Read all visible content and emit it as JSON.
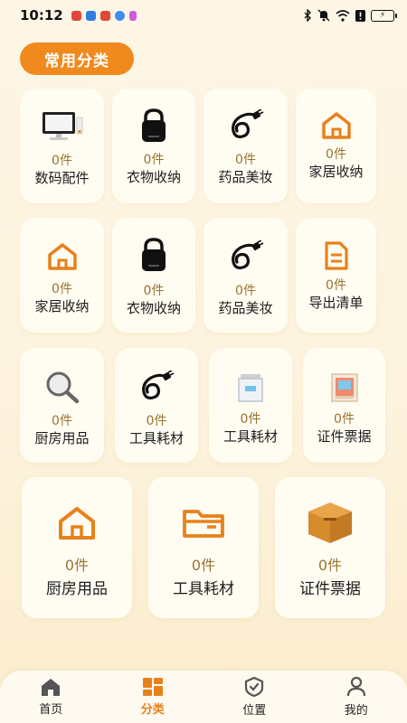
{
  "status_bar": {
    "time": "10:12",
    "battery_glyph": "⚡"
  },
  "section": {
    "title": "常用分类"
  },
  "row1": [
    {
      "icon": "monitor-icon",
      "count": "0件",
      "label": "数码配件"
    },
    {
      "icon": "lock-icon",
      "count": "0件",
      "label": "衣物收纳"
    },
    {
      "icon": "cable-icon",
      "count": "0件",
      "label": "药品美妆"
    },
    {
      "icon": "home-icon",
      "count": "0件",
      "label": "家居收纳"
    }
  ],
  "row2": [
    {
      "icon": "home-icon",
      "count": "0件",
      "label": "家居收纳"
    },
    {
      "icon": "lock-icon",
      "count": "0件",
      "label": "衣物收纳"
    },
    {
      "icon": "cable-icon",
      "count": "0件",
      "label": "药品美妆"
    },
    {
      "icon": "document-icon",
      "count": "0件",
      "label": "导出清单"
    }
  ],
  "row3": [
    {
      "icon": "magnifier-icon",
      "count": "0件",
      "label": "厨房用品"
    },
    {
      "icon": "cable-icon",
      "count": "0件",
      "label": "工具耗材"
    },
    {
      "icon": "box-icon",
      "count": "0件",
      "label": "工具耗材"
    },
    {
      "icon": "picture-icon",
      "count": "0件",
      "label": "证件票据"
    }
  ],
  "row4": [
    {
      "icon": "home-icon",
      "count": "0件",
      "label": "厨房用品"
    },
    {
      "icon": "folder-icon",
      "count": "0件",
      "label": "工具耗材"
    },
    {
      "icon": "package-icon",
      "count": "0件",
      "label": "证件票据"
    }
  ],
  "tabbar": {
    "items": [
      {
        "icon": "home-tab-icon",
        "label": "首页"
      },
      {
        "icon": "category-tab-icon",
        "label": "分类"
      },
      {
        "icon": "location-tab-icon",
        "label": "位置"
      },
      {
        "icon": "profile-tab-icon",
        "label": "我的"
      }
    ],
    "active_index": 1
  },
  "colors": {
    "accent": "#f08a1e",
    "count": "#9a7430",
    "card": "#fffcf2"
  }
}
